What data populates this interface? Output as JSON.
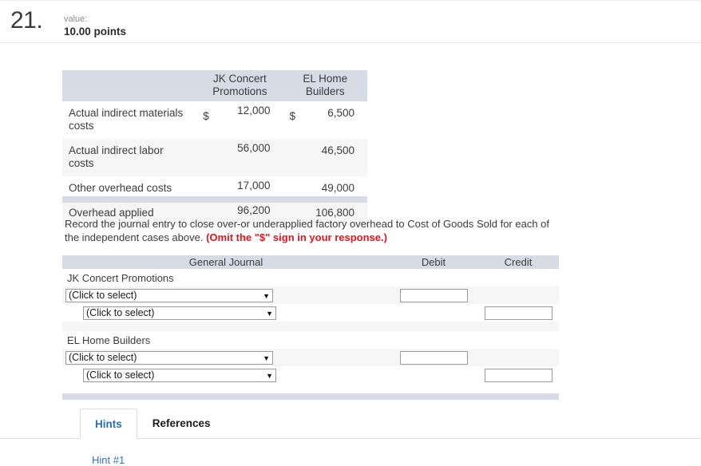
{
  "question": {
    "number": "21.",
    "value_label": "value:",
    "points": "10.00 points"
  },
  "data_table": {
    "headers": [
      "",
      "JK Concert Promotions",
      "EL Home Builders"
    ],
    "header_lines": {
      "col1_line1": "JK Concert",
      "col1_line2": "Promotions",
      "col2_line1": "EL Home",
      "col2_line2": "Builders"
    },
    "rows": [
      {
        "label": "Actual indirect materials costs",
        "jk_symbol": "$",
        "jk_amount": "12,000",
        "el_symbol": "$",
        "el_amount": "6,500"
      },
      {
        "label": "Actual indirect labor costs",
        "jk_symbol": "",
        "jk_amount": "56,000",
        "el_symbol": "",
        "el_amount": "46,500"
      },
      {
        "label": "Other overhead costs",
        "jk_symbol": "",
        "jk_amount": "17,000",
        "el_symbol": "",
        "el_amount": "49,000"
      },
      {
        "label": "Overhead applied",
        "jk_symbol": "",
        "jk_amount": "96,200",
        "el_symbol": "",
        "el_amount": "106,800"
      }
    ]
  },
  "instructions": {
    "main": "Record the journal entry to close over-or underapplied factory overhead to Cost of Goods Sold for each of the independent cases above.",
    "omit_note": "(Omit the \"$\" sign in your response.)"
  },
  "journal": {
    "headers": {
      "general_journal": "General Journal",
      "debit": "Debit",
      "credit": "Credit"
    },
    "cases": [
      {
        "case_label": "JK Concert Promotions",
        "lines": [
          {
            "account_placeholder": "(Click to select)",
            "indent": 0,
            "amount_side": "debit",
            "amount_value": ""
          },
          {
            "account_placeholder": "(Click to select)",
            "indent": 1,
            "amount_side": "credit",
            "amount_value": ""
          }
        ]
      },
      {
        "case_label": "EL Home Builders",
        "lines": [
          {
            "account_placeholder": "(Click to select)",
            "indent": 0,
            "amount_side": "debit",
            "amount_value": ""
          },
          {
            "account_placeholder": "(Click to select)",
            "indent": 1,
            "amount_side": "credit",
            "amount_value": ""
          }
        ]
      }
    ],
    "select_caret": "▼"
  },
  "tabs": {
    "items": [
      {
        "label": "Hints",
        "active": true
      },
      {
        "label": "References",
        "active": false
      }
    ],
    "hint_link": "Hint #1"
  },
  "colors": {
    "header_band": "#d6dbe6",
    "stripe": "#f6f6f7",
    "accent_blue": "#2a6fb5",
    "warning_red": "#e8141b"
  }
}
